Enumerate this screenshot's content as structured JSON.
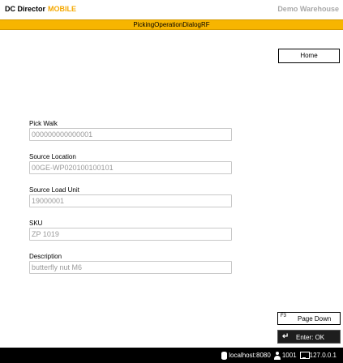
{
  "header": {
    "app_name": "DC Director",
    "app_suffix": "MOBILE",
    "warehouse": "Demo Warehouse",
    "colors": {
      "accent": "#f7b500",
      "suffix": "#f5a800",
      "warehouse_text": "#a8a8a8"
    }
  },
  "titlebar": {
    "title": "PickingOperationDialogRF"
  },
  "home_button": {
    "label": "Home"
  },
  "fields": [
    {
      "label": "Pick Walk",
      "value": "000000000000001"
    },
    {
      "label": "Source Location",
      "value": "00GE-WP020100100101"
    },
    {
      "label": "Source Load Unit",
      "value": "19000001"
    },
    {
      "label": "SKU",
      "value": "ZP 1019"
    },
    {
      "label": "Description",
      "value": "butterfly nut M6"
    }
  ],
  "page_down_button": {
    "key": "F3",
    "label": "Page Down"
  },
  "ok_button": {
    "icon": "enter-icon",
    "label": "Enter: OK"
  },
  "status_bar": {
    "server": "localhost:8080",
    "user": "1001",
    "client": "127.0.0.1",
    "icons": [
      "database-icon",
      "user-icon",
      "monitor-icon"
    ]
  }
}
